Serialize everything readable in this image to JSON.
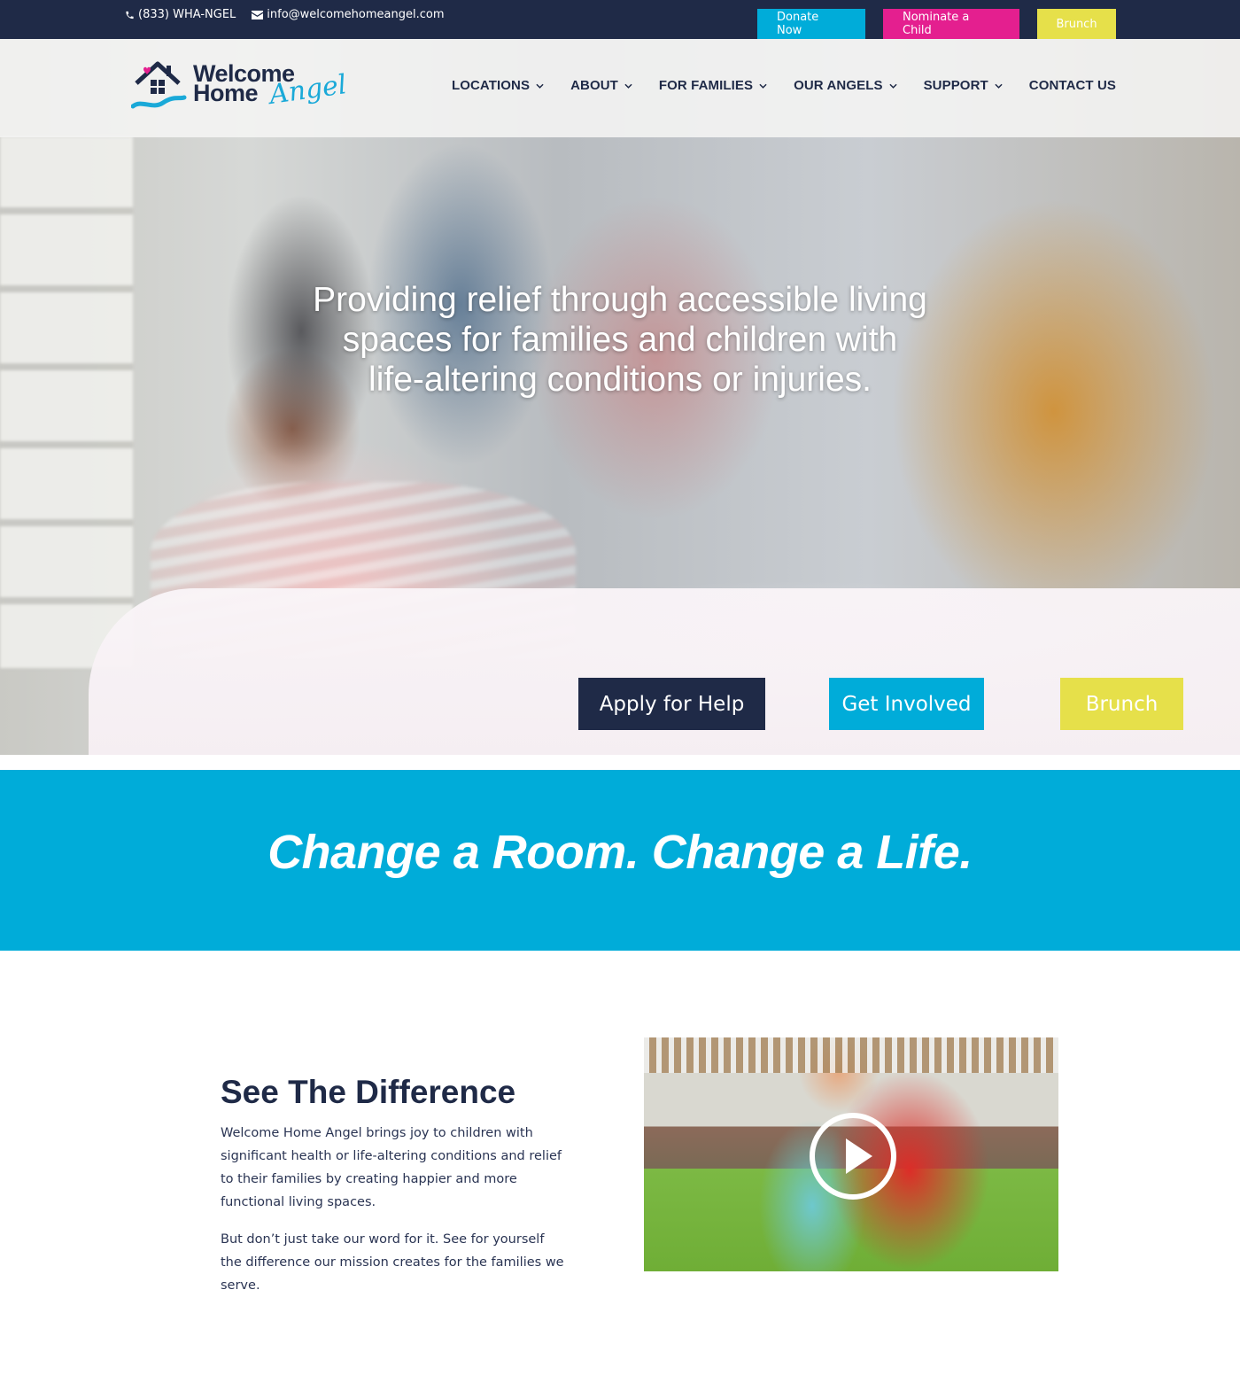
{
  "topbar": {
    "phone": "(833) WHA-NGEL",
    "email": "info@welcomehomeangel.com",
    "buttons": {
      "donate": "Donate Now",
      "nominate": "Nominate a Child",
      "brunch": "Brunch"
    }
  },
  "header": {
    "logo": {
      "line1": "Welcome",
      "line2": "Home",
      "script": "Angel"
    },
    "nav": [
      {
        "label": "LOCATIONS",
        "dropdown": true
      },
      {
        "label": "ABOUT",
        "dropdown": true
      },
      {
        "label": "FOR FAMILIES",
        "dropdown": true
      },
      {
        "label": "OUR ANGELS",
        "dropdown": true
      },
      {
        "label": "SUPPORT",
        "dropdown": true
      },
      {
        "label": "CONTACT US",
        "dropdown": false
      }
    ]
  },
  "hero": {
    "headline": "Providing relief through accessible living spaces for families and children with life-altering conditions or injuries.",
    "buttons": {
      "apply": "Apply for Help",
      "involved": "Get Involved",
      "brunch": "Brunch"
    }
  },
  "band": {
    "tagline": "Change a Room. Change a Life."
  },
  "difference": {
    "title": "See The Difference",
    "paragraph1": "Welcome Home Angel brings joy to children with significant health or life-altering conditions and relief to their families by creating happier and more functional living spaces.",
    "paragraph2": "But don’t just take our word for it. See for yourself the difference our mission creates for the families we serve.",
    "video_icon": "play-icon"
  },
  "colors": {
    "navy": "#1f2a47",
    "cyan": "#00acd9",
    "magenta": "#e41f8f",
    "yellow": "#e6e04a"
  }
}
